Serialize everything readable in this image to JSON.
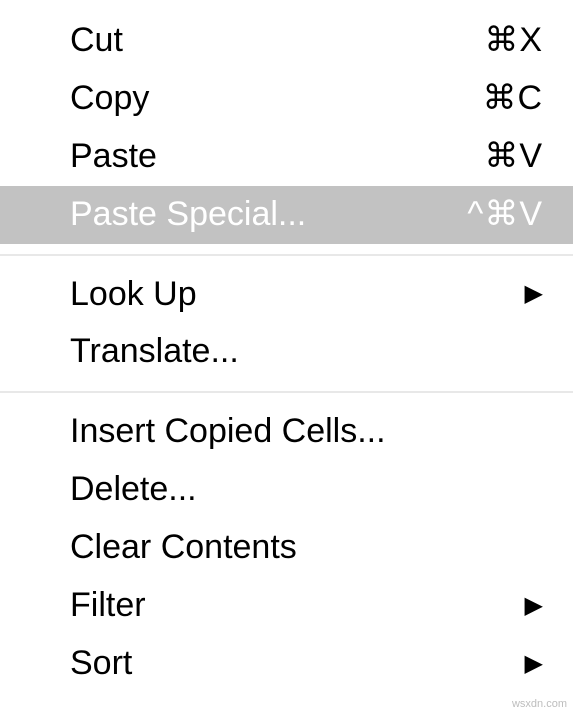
{
  "menu": {
    "groups": [
      {
        "items": [
          {
            "id": "cut",
            "label": "Cut",
            "shortcut": "⌘X",
            "hasSubmenu": false,
            "highlighted": false
          },
          {
            "id": "copy",
            "label": "Copy",
            "shortcut": "⌘C",
            "hasSubmenu": false,
            "highlighted": false
          },
          {
            "id": "paste",
            "label": "Paste",
            "shortcut": "⌘V",
            "hasSubmenu": false,
            "highlighted": false
          },
          {
            "id": "paste-special",
            "label": "Paste Special...",
            "shortcut": "^⌘V",
            "hasSubmenu": false,
            "highlighted": true
          }
        ]
      },
      {
        "items": [
          {
            "id": "look-up",
            "label": "Look Up",
            "shortcut": "",
            "hasSubmenu": true,
            "highlighted": false
          },
          {
            "id": "translate",
            "label": "Translate...",
            "shortcut": "",
            "hasSubmenu": false,
            "highlighted": false
          }
        ]
      },
      {
        "items": [
          {
            "id": "insert-copied-cells",
            "label": "Insert Copied Cells...",
            "shortcut": "",
            "hasSubmenu": false,
            "highlighted": false
          },
          {
            "id": "delete",
            "label": "Delete...",
            "shortcut": "",
            "hasSubmenu": false,
            "highlighted": false
          },
          {
            "id": "clear-contents",
            "label": "Clear Contents",
            "shortcut": "",
            "hasSubmenu": false,
            "highlighted": false
          },
          {
            "id": "filter",
            "label": "Filter",
            "shortcut": "",
            "hasSubmenu": true,
            "highlighted": false
          },
          {
            "id": "sort",
            "label": "Sort",
            "shortcut": "",
            "hasSubmenu": true,
            "highlighted": false
          }
        ]
      }
    ]
  },
  "watermark": "wsxdn.com",
  "icons": {
    "submenuArrow": "▶"
  }
}
